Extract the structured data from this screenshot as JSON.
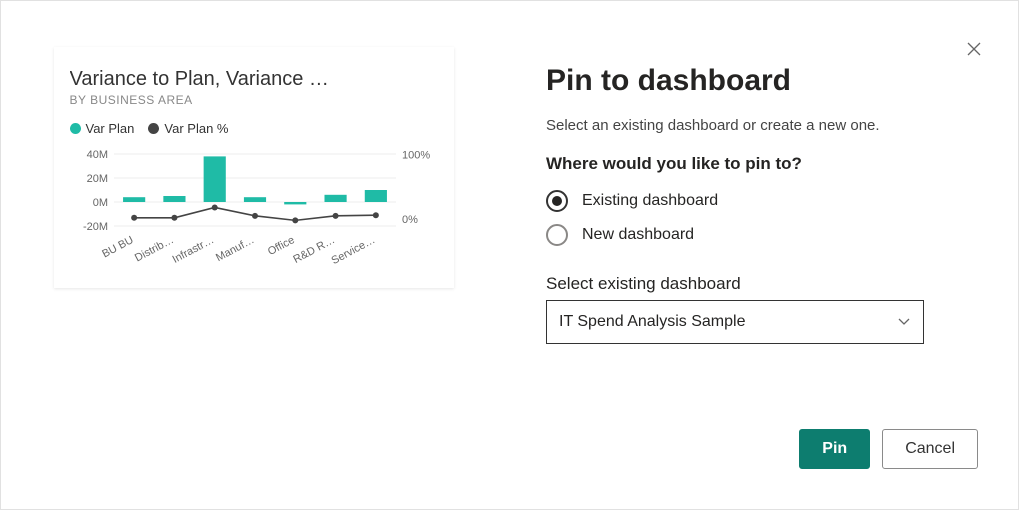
{
  "tile": {
    "title": "Variance to Plan, Variance …",
    "subtitle": "BY BUSINESS AREA",
    "legend": [
      {
        "label": "Var Plan",
        "color": "#1fbba6"
      },
      {
        "label": "Var Plan %",
        "color": "#444444"
      }
    ]
  },
  "chart_data": {
    "type": "bar",
    "categories": [
      "BU BU",
      "Distrib…",
      "Infrastr…",
      "Manuf…",
      "Office",
      "R&D R…",
      "Service…"
    ],
    "series": [
      {
        "name": "Var Plan",
        "axis": "left",
        "type": "bar",
        "values": [
          4,
          5,
          38,
          4,
          -2,
          6,
          10
        ]
      },
      {
        "name": "Var Plan %",
        "axis": "right",
        "type": "line",
        "values": [
          2,
          2,
          18,
          5,
          -2,
          5,
          6
        ]
      }
    ],
    "y_left": {
      "label": "",
      "ticks": [
        -20,
        0,
        20,
        40
      ],
      "tick_labels": [
        "-20M",
        "0M",
        "20M",
        "40M"
      ],
      "min": -25,
      "max": 45
    },
    "y_right": {
      "label": "",
      "ticks": [
        0,
        100
      ],
      "tick_labels": [
        "0%",
        "100%"
      ],
      "min": -20,
      "max": 110
    }
  },
  "dialog": {
    "title": "Pin to dashboard",
    "description": "Select an existing dashboard or create a new one.",
    "where_label": "Where would you like to pin to?",
    "radios": [
      {
        "label": "Existing dashboard",
        "checked": true
      },
      {
        "label": "New dashboard",
        "checked": false
      }
    ],
    "select_label": "Select existing dashboard",
    "select_value": "IT Spend Analysis Sample",
    "pin_label": "Pin",
    "cancel_label": "Cancel"
  },
  "colors": {
    "accent": "#1fbba6",
    "primary_btn": "#0d7d6f"
  }
}
